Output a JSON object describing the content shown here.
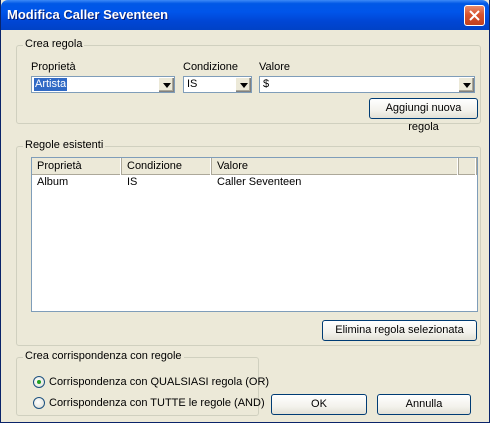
{
  "window": {
    "title": "Modifica Caller Seventeen"
  },
  "create_rule": {
    "legend": "Crea regola",
    "property_label": "Proprietà",
    "property_value": "Artista",
    "condition_label": "Condizione",
    "condition_value": "IS",
    "value_label": "Valore",
    "value_value": "$",
    "add_button": "Aggiungi nuova regola"
  },
  "existing_rules": {
    "legend": "Regole esistenti",
    "columns": [
      "Proprietà",
      "Condizione",
      "Valore"
    ],
    "rows": [
      {
        "property": "Album",
        "condition": "IS",
        "value": "Caller Seventeen"
      }
    ],
    "delete_button": "Elimina regola selezionata"
  },
  "matching": {
    "legend": "Crea corrispondenza con regole",
    "options": [
      {
        "label": "Corrispondenza con QUALSIASI regola (OR)",
        "selected": true
      },
      {
        "label": "Corrispondenza con TUTTE le regole (AND)",
        "selected": false
      }
    ]
  },
  "buttons": {
    "ok": "OK",
    "cancel": "Annulla"
  }
}
